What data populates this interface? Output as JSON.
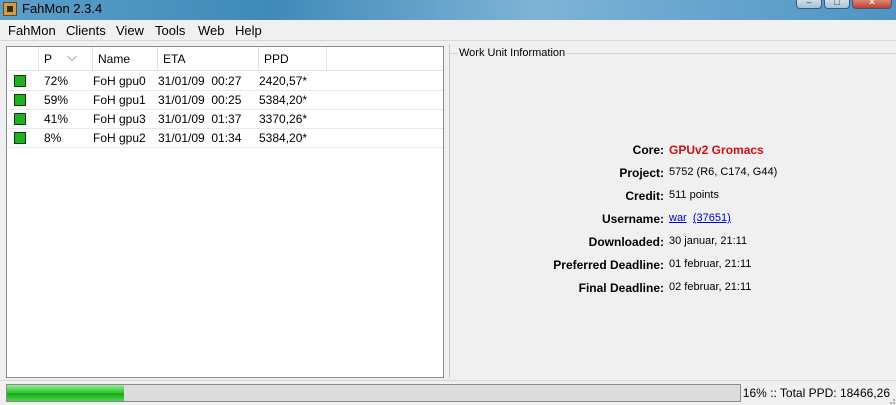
{
  "window": {
    "title": "FahMon 2.3.4",
    "buttons": [
      "minimize",
      "maximize",
      "close"
    ]
  },
  "menu": [
    {
      "label": "FahMon"
    },
    {
      "label": "Clients"
    },
    {
      "label": "View"
    },
    {
      "label": "Tools"
    },
    {
      "label": "Web"
    },
    {
      "label": "Help"
    }
  ],
  "table": {
    "columns": [
      "P",
      "Name",
      "ETA",
      "PPD"
    ],
    "rows": [
      {
        "status": "green",
        "progress": "72%",
        "name": "FoH gpu0",
        "eta": "31/01/09  00:27",
        "ppd": "2420,57*"
      },
      {
        "status": "green",
        "progress": "59%",
        "name": "FoH gpu1",
        "eta": "31/01/09  00:25",
        "ppd": "5384,20*"
      },
      {
        "status": "green",
        "progress": "41%",
        "name": "FoH gpu3",
        "eta": "31/01/09  01:37",
        "ppd": "3370,26*"
      },
      {
        "status": "green",
        "progress": "8%",
        "name": "FoH gpu2",
        "eta": "31/01/09  01:34",
        "ppd": "5384,20*"
      }
    ]
  },
  "work_unit": {
    "title": "Work Unit Information",
    "core": {
      "label": "Core:",
      "value": "GPUv2 Gromacs"
    },
    "project": {
      "label": "Project:",
      "value": "5752 (R6, C174, G44)"
    },
    "credit": {
      "label": "Credit:",
      "value": "511 points"
    },
    "username": {
      "label": "Username:",
      "name": "war",
      "team": "(37651)"
    },
    "downloaded": {
      "label": "Downloaded:",
      "value": "30 januar, 21:11"
    },
    "preferred_deadline": {
      "label": "Preferred Deadline:",
      "value": "01 februar, 21:11"
    },
    "final_deadline": {
      "label": "Final Deadline:",
      "value": "02 februar, 21:11"
    }
  },
  "status": {
    "progress_fraction": 0.16,
    "text": "16% :: Total PPD: 18466,26"
  },
  "colors": {
    "core_value": "#d01010",
    "status_ok": "#22b022",
    "link": "#0000cc"
  }
}
